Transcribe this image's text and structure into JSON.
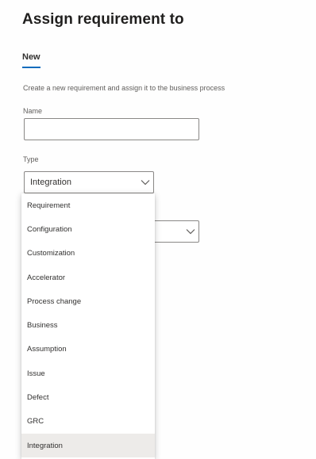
{
  "panel": {
    "title": "Assign requirement to"
  },
  "tabs": [
    {
      "label": "New",
      "selected": true
    }
  ],
  "form": {
    "description": "Create a new requirement and assign it to the business process",
    "name": {
      "label": "Name",
      "value": ""
    },
    "type": {
      "label": "Type",
      "value": "Integration"
    },
    "second_select": {
      "value": ""
    }
  },
  "type_dropdown": {
    "options": [
      "Requirement",
      "Configuration",
      "Customization",
      "Accelerator",
      "Process change",
      "Business",
      "Assumption",
      "Issue",
      "Defect",
      "GRC",
      "Integration"
    ],
    "selected": "Integration"
  },
  "icons": {
    "select_chevron": "chevron-down-icon"
  },
  "colors": {
    "accent": "#0f6cbd",
    "selected_option_bg": "#edebe9",
    "border": "#8a8886"
  }
}
